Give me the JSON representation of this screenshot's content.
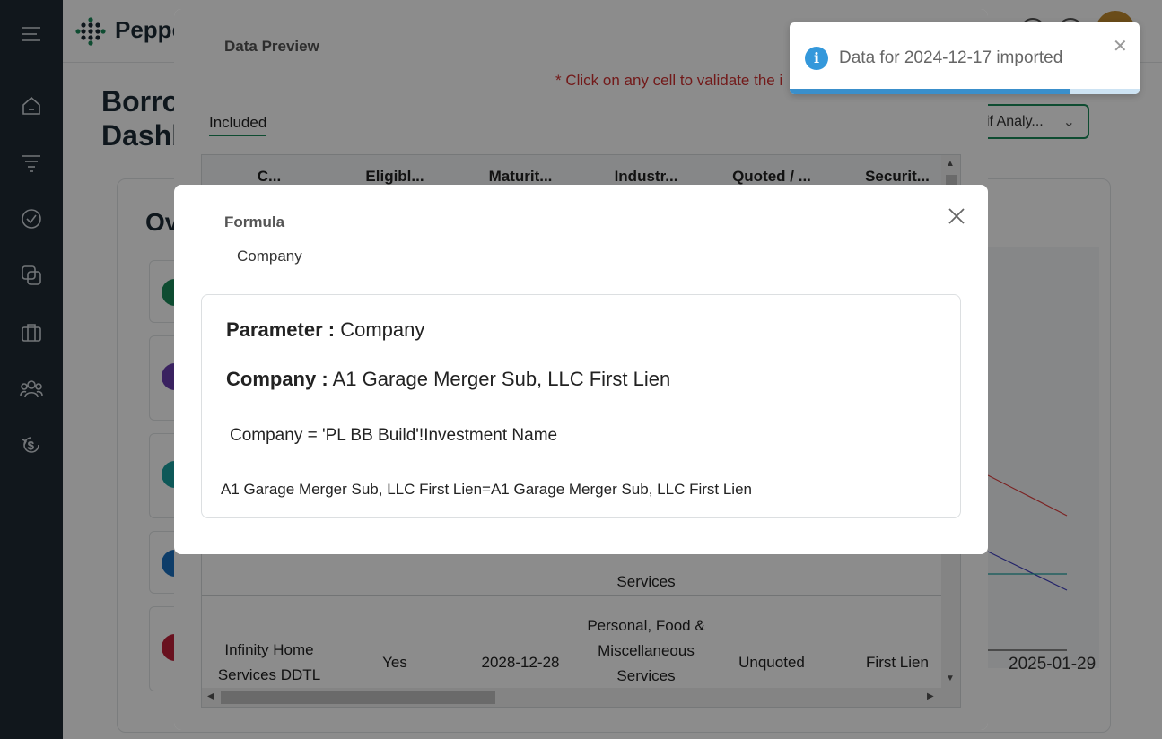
{
  "header": {
    "logo_text": "Peppe"
  },
  "page": {
    "title_line1": "Borro",
    "title_line2": "Dashb",
    "select_value": "if Analy...",
    "overview_title": "Ov",
    "axis_date": "2025-01-29"
  },
  "data_preview": {
    "title": "Data Preview",
    "note": "* Click on any cell to validate the i",
    "tab_label": "Included",
    "columns": [
      "C...",
      "Eligibl...",
      "Maturit...",
      "Industr...",
      "Quoted / ...",
      "Securit..."
    ],
    "partial_cell": "Services",
    "row": {
      "company": "Infinity Home Services DDTL",
      "eligible": "Yes",
      "maturity": "2028-12-28",
      "industry": "Personal, Food & Miscellaneous Services",
      "quoted": "Unquoted",
      "security": "First Lien"
    }
  },
  "formula_modal": {
    "title": "Formula",
    "subtitle": "Company",
    "parameter_label": "Parameter :",
    "parameter_value": "Company",
    "company_label": "Company :",
    "company_value": "A1 Garage Merger Sub, LLC First Lien",
    "formula_text": "Company = 'PL BB Build'!Investment Name",
    "evaluated_text": "A1 Garage Merger Sub, LLC First Lien=A1 Garage Merger Sub, LLC First Lien"
  },
  "toast": {
    "message": "Data for 2024-12-17 imported",
    "progress": 0.8
  },
  "colors": {
    "sidebar": "#1f2a33",
    "accent": "#1a8a5a",
    "toast_info": "#3498db",
    "note_red": "#d03030"
  }
}
